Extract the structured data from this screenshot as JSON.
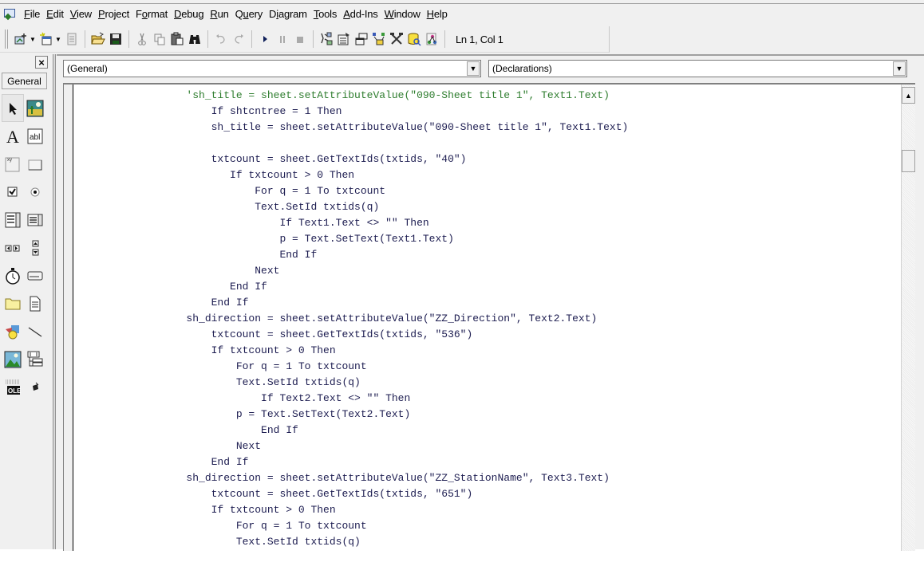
{
  "menubar": {
    "app_icon": "vb-ide-icon",
    "items": [
      {
        "label": "File",
        "accel": "F"
      },
      {
        "label": "Edit",
        "accel": "E"
      },
      {
        "label": "View",
        "accel": "V"
      },
      {
        "label": "Project",
        "accel": "P"
      },
      {
        "label": "Format",
        "accel": "o"
      },
      {
        "label": "Debug",
        "accel": "D"
      },
      {
        "label": "Run",
        "accel": "R"
      },
      {
        "label": "Query",
        "accel": "u"
      },
      {
        "label": "Diagram",
        "accel": "i"
      },
      {
        "label": "Tools",
        "accel": "T"
      },
      {
        "label": "Add-Ins",
        "accel": "A"
      },
      {
        "label": "Window",
        "accel": "W"
      },
      {
        "label": "Help",
        "accel": "H"
      }
    ]
  },
  "toolbar": {
    "buttons": [
      {
        "name": "add-project",
        "icon": "add-project-icon"
      },
      {
        "name": "add-form",
        "icon": "add-form-icon"
      },
      {
        "name": "menu-editor",
        "icon": "menu-editor-icon"
      },
      {
        "name": "open-project",
        "icon": "folder-open-icon"
      },
      {
        "name": "save-project",
        "icon": "save-icon"
      },
      {
        "name": "cut",
        "icon": "scissors-icon"
      },
      {
        "name": "copy",
        "icon": "copy-icon"
      },
      {
        "name": "paste",
        "icon": "paste-icon"
      },
      {
        "name": "find",
        "icon": "binoculars-icon"
      },
      {
        "name": "undo",
        "icon": "undo-icon"
      },
      {
        "name": "redo",
        "icon": "redo-icon"
      },
      {
        "name": "start",
        "icon": "play-icon"
      },
      {
        "name": "break",
        "icon": "pause-icon"
      },
      {
        "name": "end",
        "icon": "stop-icon"
      },
      {
        "name": "project-explorer",
        "icon": "project-explorer-icon"
      },
      {
        "name": "properties-window",
        "icon": "properties-icon"
      },
      {
        "name": "form-layout",
        "icon": "form-layout-icon"
      },
      {
        "name": "object-browser",
        "icon": "object-browser-icon"
      },
      {
        "name": "toolbox",
        "icon": "toolbox-icon"
      },
      {
        "name": "data-view",
        "icon": "data-view-icon"
      },
      {
        "name": "component-manager",
        "icon": "component-manager-icon"
      }
    ],
    "cursor_position": "Ln 1, Col 1"
  },
  "toolbox": {
    "close_label": "×",
    "tab_label": "General",
    "tools": [
      "Pointer",
      "PictureBox",
      "Label",
      "TextBox",
      "Frame",
      "CommandButton",
      "CheckBox",
      "OptionButton",
      "ComboBox",
      "ListBox",
      "HScrollBar",
      "VScrollBar",
      "Timer",
      "DriveListBox",
      "DirListBox",
      "FileListBox",
      "Shape",
      "Line",
      "Image",
      "Data",
      "OLE",
      "Extra control"
    ]
  },
  "code_window": {
    "object_combo": "(General)",
    "procedure_combo": "(Declarations)",
    "lines": [
      {
        "text": "                  'sh_title = sheet.setAttributeValue(\"090-Sheet title 1\", Text1.Text)",
        "type": "comment"
      },
      {
        "text": "                      If shtcntree = 1 Then",
        "type": "code"
      },
      {
        "text": "                      sh_title = sheet.setAttributeValue(\"090-Sheet title 1\", Text1.Text)",
        "type": "code"
      },
      {
        "text": "",
        "type": "code"
      },
      {
        "text": "                      txtcount = sheet.GetTextIds(txtids, \"40\")",
        "type": "code"
      },
      {
        "text": "                         If txtcount > 0 Then",
        "type": "code"
      },
      {
        "text": "                             For q = 1 To txtcount",
        "type": "code"
      },
      {
        "text": "                             Text.SetId txtids(q)",
        "type": "code"
      },
      {
        "text": "                                 If Text1.Text <> \"\" Then",
        "type": "code"
      },
      {
        "text": "                                 p = Text.SetText(Text1.Text)",
        "type": "code"
      },
      {
        "text": "                                 End If",
        "type": "code"
      },
      {
        "text": "                             Next",
        "type": "code"
      },
      {
        "text": "                         End If",
        "type": "code"
      },
      {
        "text": "                      End If",
        "type": "code"
      },
      {
        "text": "                  sh_direction = sheet.setAttributeValue(\"ZZ_Direction\", Text2.Text)",
        "type": "code"
      },
      {
        "text": "                      txtcount = sheet.GetTextIds(txtids, \"536\")",
        "type": "code"
      },
      {
        "text": "                      If txtcount > 0 Then",
        "type": "code"
      },
      {
        "text": "                          For q = 1 To txtcount",
        "type": "code"
      },
      {
        "text": "                          Text.SetId txtids(q)",
        "type": "code"
      },
      {
        "text": "                              If Text2.Text <> \"\" Then",
        "type": "code"
      },
      {
        "text": "                          p = Text.SetText(Text2.Text)",
        "type": "code"
      },
      {
        "text": "                              End If",
        "type": "code"
      },
      {
        "text": "                          Next",
        "type": "code"
      },
      {
        "text": "                      End If",
        "type": "code"
      },
      {
        "text": "                  sh_direction = sheet.setAttributeValue(\"ZZ_StationName\", Text3.Text)",
        "type": "code"
      },
      {
        "text": "                      txtcount = sheet.GetTextIds(txtids, \"651\")",
        "type": "code"
      },
      {
        "text": "                      If txtcount > 0 Then",
        "type": "code"
      },
      {
        "text": "                          For q = 1 To txtcount",
        "type": "code"
      },
      {
        "text": "                          Text.SetId txtids(q)",
        "type": "code"
      }
    ]
  },
  "colors": {
    "code_text": "#1c1c50",
    "comment": "#2e7d2e",
    "chrome": "#f0f0f0"
  }
}
